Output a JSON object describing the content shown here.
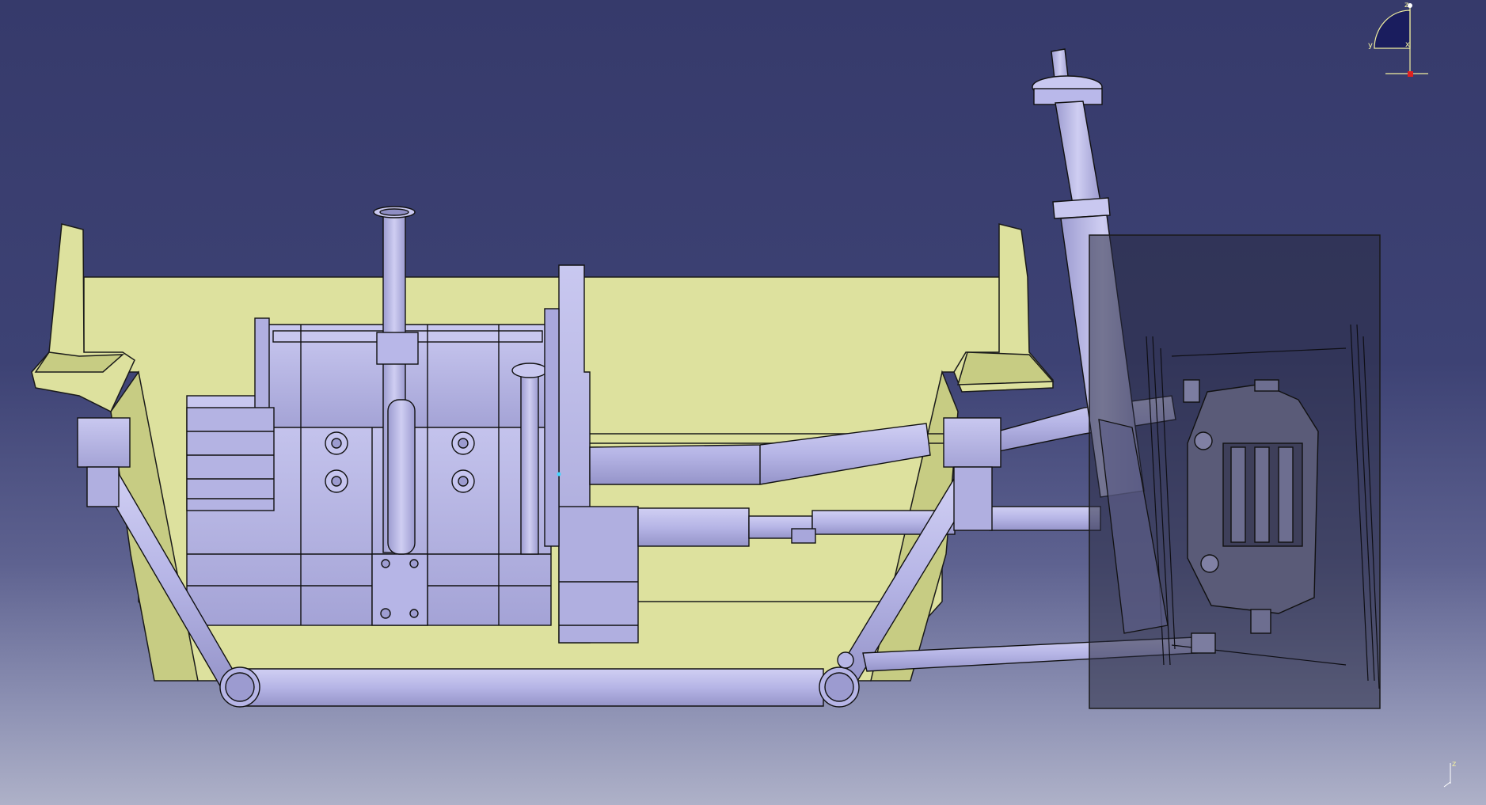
{
  "viewer": {
    "type": "3D CAD viewport",
    "background": {
      "top": "#363a6b",
      "bottom": "#aeb1c8"
    },
    "model_colors": {
      "part": "#b9b8ea",
      "part_shade": "#9c9bd0",
      "body": "#dde19e",
      "body_shade": "#c7cc83",
      "edges": "#111111",
      "translucent": "#2a2c44"
    }
  },
  "compass": {
    "x_label": "x",
    "y_label": "y",
    "z_label": "z"
  },
  "axis_triad": {
    "z_label": "z"
  }
}
